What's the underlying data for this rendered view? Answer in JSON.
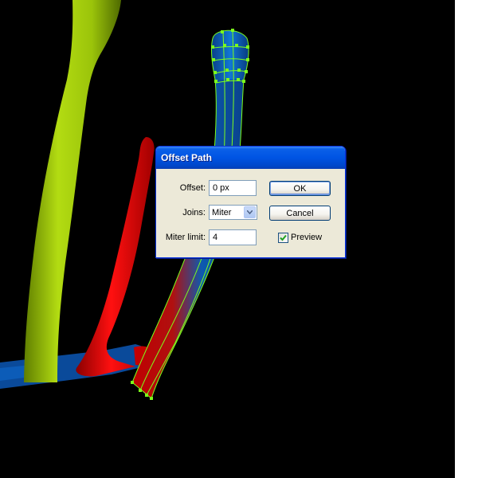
{
  "dialog": {
    "title": "Offset Path",
    "offset": {
      "label": "Offset:",
      "value": "0 px"
    },
    "joins": {
      "label": "Joins:",
      "value": "Miter"
    },
    "miter_limit": {
      "label": "Miter limit:",
      "value": "4"
    },
    "ok_label": "OK",
    "cancel_label": "Cancel",
    "preview": {
      "label": "Preview",
      "checked": true
    }
  },
  "colors": {
    "canvas_background": "#000000",
    "lime_stem": "#9fce0a",
    "red_stem": "#e00000",
    "blue_stem": "#0a5fb0",
    "selection_anchor": "#7cff1c"
  }
}
